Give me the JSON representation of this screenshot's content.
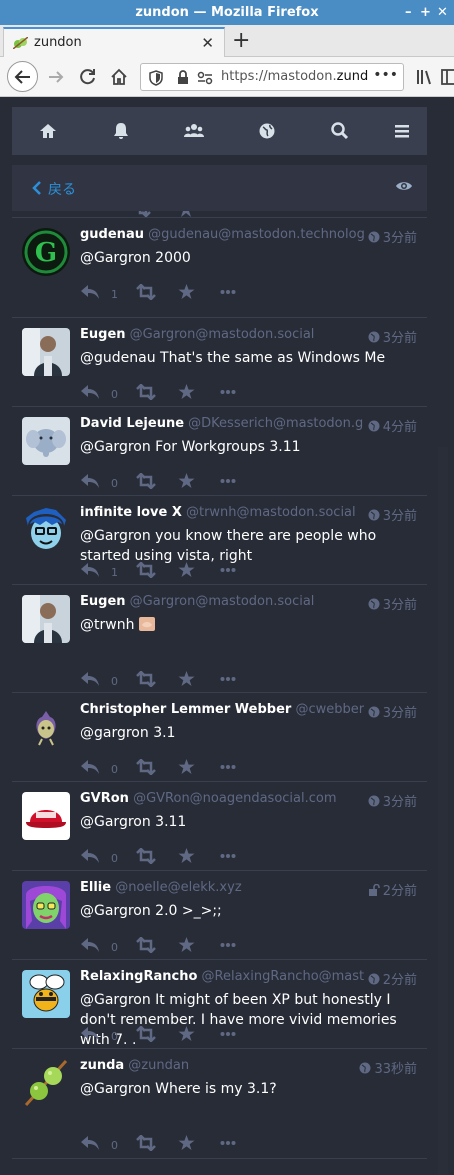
{
  "window": {
    "title": "zundon — Mozilla Firefox"
  },
  "tab": {
    "label": "zundon"
  },
  "url": {
    "prefix": "https://mastodon.",
    "domain": "zunda.n"
  },
  "column": {
    "back_label": "戻る"
  },
  "statuses": [
    {
      "name": "gudenau",
      "acct": "@gudenau@mastodon.technology",
      "time": "3分前",
      "text": "@Gargron 2000",
      "replies": "1",
      "visibility": "public"
    },
    {
      "name": "Eugen",
      "acct": "@Gargron@mastodon.social",
      "time": "3分前",
      "text": "@gudenau That's the same as Windows Me",
      "replies": "0",
      "visibility": "public"
    },
    {
      "name": "David Lejeune",
      "acct": "@DKesserich@mastodon.g...",
      "time": "4分前",
      "text": "@Gargron For Workgroups 3.11",
      "replies": "0",
      "visibility": "public"
    },
    {
      "name": "infinite love X",
      "acct": "@trwnh@mastodon.social",
      "time": "3分前",
      "text": "@Gargron you know there are people who started using vista, right",
      "replies": "1",
      "visibility": "public"
    },
    {
      "name": "Eugen",
      "acct": "@Gargron@mastodon.social",
      "time": "3分前",
      "text": "@trwnh",
      "replies": "0",
      "visibility": "public"
    },
    {
      "name": "Christopher Lemmer Webber",
      "acct": "@cwebber...",
      "time": "3分前",
      "text": "@gargron 3.1",
      "replies": "0",
      "visibility": "public"
    },
    {
      "name": "GVRon",
      "acct": "@GVRon@noagendasocial.com",
      "time": "3分前",
      "text": "@Gargron 3.11",
      "replies": "0",
      "visibility": "public"
    },
    {
      "name": "Ellie",
      "acct": "@noelle@elekk.xyz",
      "time": "2分前",
      "text": "@Gargron 2.0 >_>;;",
      "replies": "0",
      "visibility": "unlisted"
    },
    {
      "name": "RelaxingRancho",
      "acct": "@RelaxingRancho@mast...",
      "time": "2分前",
      "text": "@Gargron It might of been XP but honestly I don't remember. I have more vivid memories with 7. .",
      "replies": "0",
      "visibility": "public"
    },
    {
      "name": "zunda",
      "acct": "@zundan",
      "time": "33秒前",
      "text": "@Gargron Where is my 3.1?",
      "replies": "0",
      "visibility": "public"
    }
  ]
}
